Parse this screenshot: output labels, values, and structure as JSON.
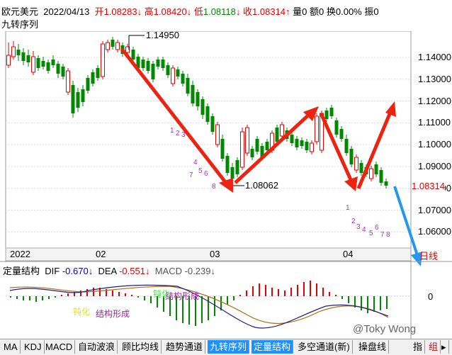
{
  "header": {
    "symbol": "欧元美元",
    "date": "2022/04/13",
    "open_label": "开",
    "open_value": "1.08283",
    "open_arrow": "↓",
    "high_label": "高",
    "high_value": "1.08420",
    "high_arrow": "↓",
    "low_label": "低",
    "low_value": "1.08118",
    "low_arrow": "↓",
    "close_label": "收",
    "close_value": "1.08314",
    "close_arrow": "↑",
    "volume": "量0",
    "amount": "额0",
    "turnover": "换0.00%",
    "amplitude": "振0",
    "indicator_name": "九转序列"
  },
  "price_axis": [
    "1.14000",
    "1.13000",
    "1.12000",
    "1.11000",
    "1.10000",
    "1.09000",
    "1.08000",
    "1.07000",
    "1.06000"
  ],
  "current_price": "1.08314",
  "annotations": {
    "high_mark": "1.14950",
    "low_mark": "1.08062"
  },
  "time_axis": [
    "2022",
    "02",
    "03",
    "04"
  ],
  "period_label": "日线",
  "nine_seq_top": [
    "1",
    "2",
    "3",
    "4",
    "5",
    "6",
    "7",
    "8"
  ],
  "nine_seq_bottom": [
    "1",
    "2",
    "3",
    "4",
    "5",
    "6",
    "7",
    "8"
  ],
  "sub_header": {
    "title": "定量结构",
    "dif_label": "DIF",
    "dif_value": "-0.670↓",
    "dea_label": "DEA",
    "dea_value": "-0.551↓",
    "macd_label": "MACD",
    "macd_value": "-0.239↓"
  },
  "sub_axis_zero": "0",
  "sub_annotations": [
    "结构形成",
    "结构形成",
    "钝化",
    "钝化"
  ],
  "watermark": "@Toky Wong",
  "tabs": [
    "MA",
    "KDJ",
    "MACD",
    "自动波浪",
    "顾比均线",
    "趋势通道",
    "九转序列",
    "定量结构",
    "多空通道(新)",
    "操盘线"
  ],
  "active_tabs": [
    "九转序列",
    "定量结构"
  ],
  "right_tabs": [
    "指",
    "组"
  ],
  "colors": {
    "up": "#e60000",
    "down": "#008800",
    "arrow_red": "#ee2211",
    "arrow_blue": "#2299ee",
    "tab_active": "#1e90ff"
  }
}
